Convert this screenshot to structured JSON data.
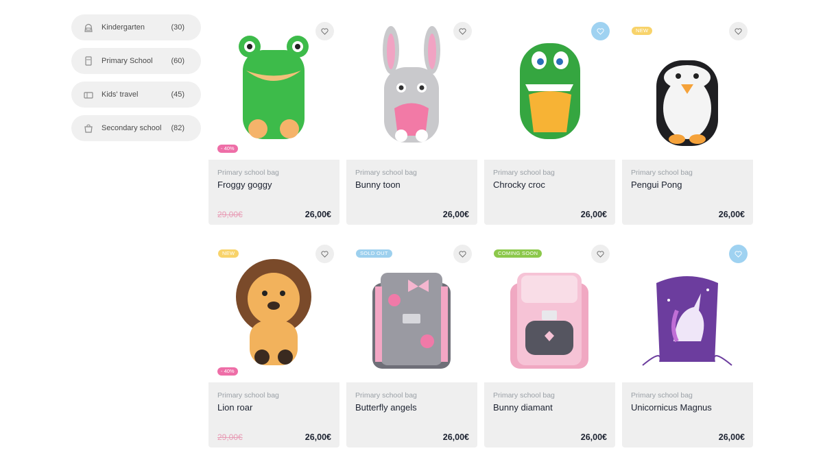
{
  "sidebar": {
    "categories": [
      {
        "label": "Kindergarten",
        "count": "(30)",
        "icon": "backpack-icon"
      },
      {
        "label": "Primary School",
        "count": "(60)",
        "icon": "school-bag-icon"
      },
      {
        "label": "Kids' travel",
        "count": "(45)",
        "icon": "suitcase-icon"
      },
      {
        "label": "Secondary school",
        "count": "(82)",
        "icon": "shopping-bag-icon"
      }
    ]
  },
  "products": [
    {
      "kind": "Primary school bag",
      "name": "Froggy goggy",
      "old_price": "29,00€",
      "price": "26,00€",
      "discount": "- 40%",
      "badge": "",
      "favorite": false
    },
    {
      "kind": "Primary school bag",
      "name": "Bunny toon",
      "old_price": "",
      "price": "26,00€",
      "discount": "",
      "badge": "",
      "favorite": false
    },
    {
      "kind": "Primary school bag",
      "name": "Chrocky croc",
      "old_price": "",
      "price": "26,00€",
      "discount": "",
      "badge": "",
      "favorite": true
    },
    {
      "kind": "Primary school bag",
      "name": "Pengui Pong",
      "old_price": "",
      "price": "26,00€",
      "discount": "",
      "badge": "NEW",
      "favorite": false
    },
    {
      "kind": "Primary school bag",
      "name": "Lion roar",
      "old_price": "29,00€",
      "price": "26,00€",
      "discount": "- 40%",
      "badge": "NEW",
      "favorite": false
    },
    {
      "kind": "Primary school bag",
      "name": "Butterfly angels",
      "old_price": "",
      "price": "26,00€",
      "discount": "",
      "badge": "SOLD OUT",
      "favorite": false
    },
    {
      "kind": "Primary school bag",
      "name": "Bunny diamant",
      "old_price": "",
      "price": "26,00€",
      "discount": "",
      "badge": "COMING SOON",
      "favorite": false
    },
    {
      "kind": "Primary school bag",
      "name": "Unicornicus Magnus",
      "old_price": "",
      "price": "26,00€",
      "discount": "",
      "badge": "",
      "favorite": true
    }
  ],
  "colors": {
    "accent_heart": "#9fd2f1",
    "discount": "#ee6ea7",
    "new": "#f8d36a",
    "sold_out": "#9dd0ee",
    "coming_soon": "#8cc84b"
  }
}
